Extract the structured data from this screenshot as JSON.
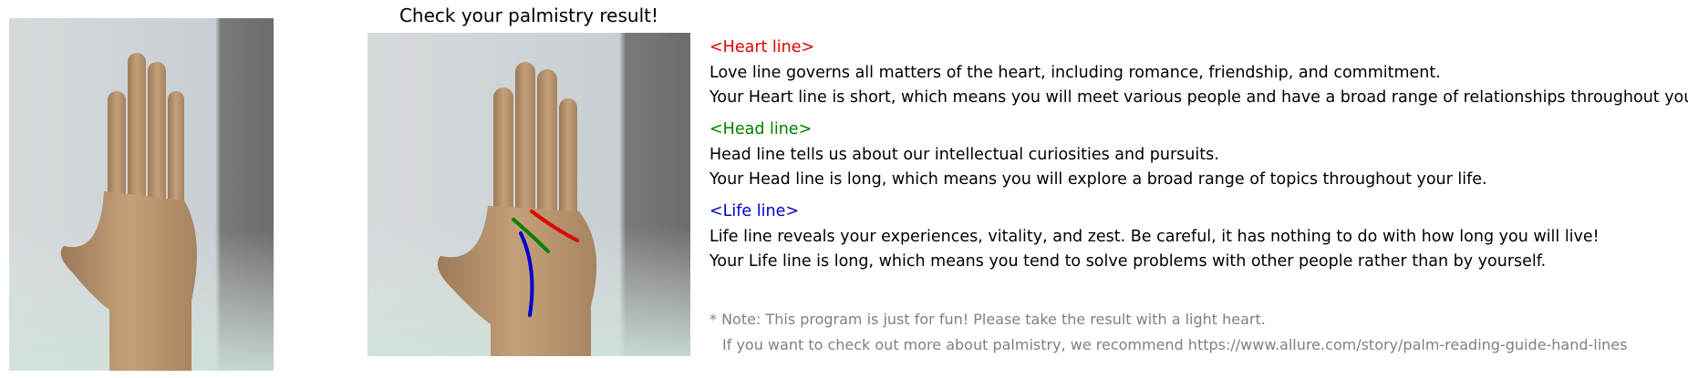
{
  "title": "Check your palmistry result!",
  "heart": {
    "header": "<Heart line>",
    "desc": "Love line governs all matters of the heart, including romance, friendship, and commitment.",
    "result": "Your Heart line is short, which means you will meet various people and have a broad range of relationships throughout your life.",
    "color": "#e00000"
  },
  "head": {
    "header": "<Head line>",
    "desc": "Head line tells us about our intellectual curiosities and pursuits.",
    "result": "Your Head line is long, which means you will explore a broad range of topics throughout your life.",
    "color": "#008000"
  },
  "life": {
    "header": "<Life line>",
    "desc": "Life line reveals your experiences, vitality, and zest. Be careful, it has nothing to do with how long you will live!",
    "result": "Your Life line is long, which means you tend to solve problems with other people rather than by yourself.",
    "color": "#0000cc"
  },
  "note": {
    "line1": "* Note: This program is just for fun! Please take the result with a light heart.",
    "line2": "If you want to check out more about palmistry, we recommend https://www.allure.com/story/palm-reading-guide-hand-lines"
  }
}
